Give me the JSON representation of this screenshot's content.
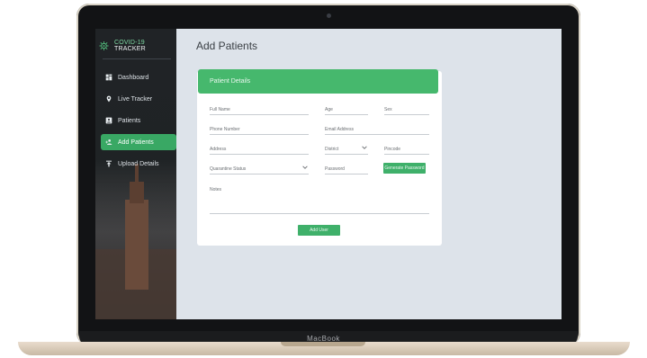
{
  "device": {
    "brand_label": "MacBook"
  },
  "app": {
    "name_part1": "COVID-19",
    "name_part2": " TRACKER"
  },
  "sidebar": {
    "items": [
      {
        "label": "Dashboard",
        "icon": "dashboard-icon",
        "active": false
      },
      {
        "label": "Live Tracker",
        "icon": "location-pin-icon",
        "active": false
      },
      {
        "label": "Patients",
        "icon": "person-card-icon",
        "active": false
      },
      {
        "label": "Add Patients",
        "icon": "add-user-icon",
        "active": true
      },
      {
        "label": "Upload Details",
        "icon": "upload-icon",
        "active": false
      }
    ]
  },
  "page": {
    "title": "Add Patients"
  },
  "form": {
    "header": "Patient Details",
    "fields": {
      "full_name": "Full Name",
      "age": "Age",
      "sex": "Sex",
      "phone": "Phone Number",
      "email": "Email Address",
      "address": "Address",
      "district": "District",
      "pincode": "Pincode",
      "quarantine_status": "Quarantine Status",
      "password": "Password",
      "notes": "Notes"
    },
    "buttons": {
      "generate_password": "Generate Password",
      "add_user": "Add User"
    }
  },
  "colors": {
    "accent": "#46b86d",
    "sidebar": "#202326",
    "screen_bg": "#dde3ea"
  }
}
